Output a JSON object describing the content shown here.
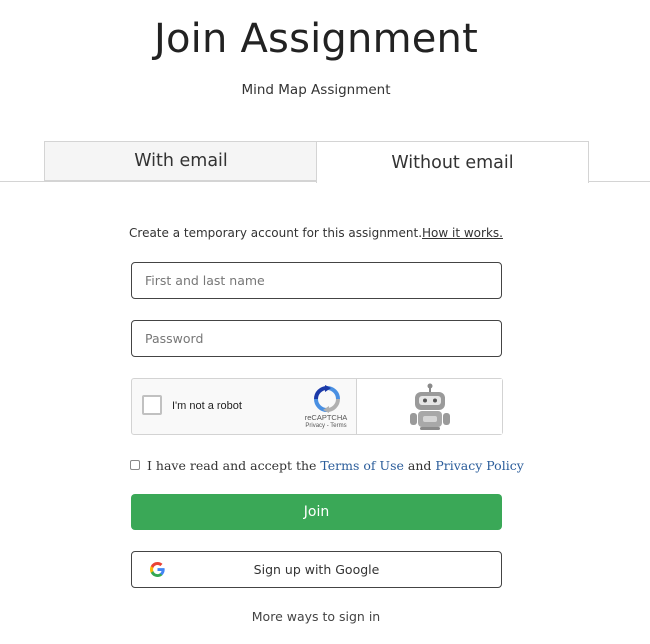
{
  "page": {
    "title": "Join Assignment",
    "subtitle": "Mind Map Assignment"
  },
  "tabs": [
    {
      "label": "With email",
      "active": false
    },
    {
      "label": "Without email",
      "active": true
    }
  ],
  "intro": {
    "text": "Create a temporary account for this assignment.",
    "link": "How it works."
  },
  "form": {
    "name_placeholder": "First and last name",
    "name_value": "",
    "password_placeholder": "Password",
    "password_value": ""
  },
  "captcha": {
    "label": "I'm not a robot",
    "brand": "reCAPTCHA",
    "links": "Privacy - Terms",
    "checked": false
  },
  "terms": {
    "prefix": "I have read and accept the ",
    "terms_link": "Terms of Use",
    "middle": " and ",
    "privacy_link": "Privacy Policy",
    "checked": false
  },
  "buttons": {
    "join_label": "Join",
    "google_label": "Sign up with Google"
  },
  "more_ways": "More ways to sign in",
  "icons": {
    "google": "google-g-icon",
    "recaptcha": "recaptcha-icon",
    "robot": "robot-icon"
  },
  "colors": {
    "join_button": "#3aa857",
    "link": "#2a5c9a",
    "tab_inactive_bg": "#f5f5f5"
  }
}
